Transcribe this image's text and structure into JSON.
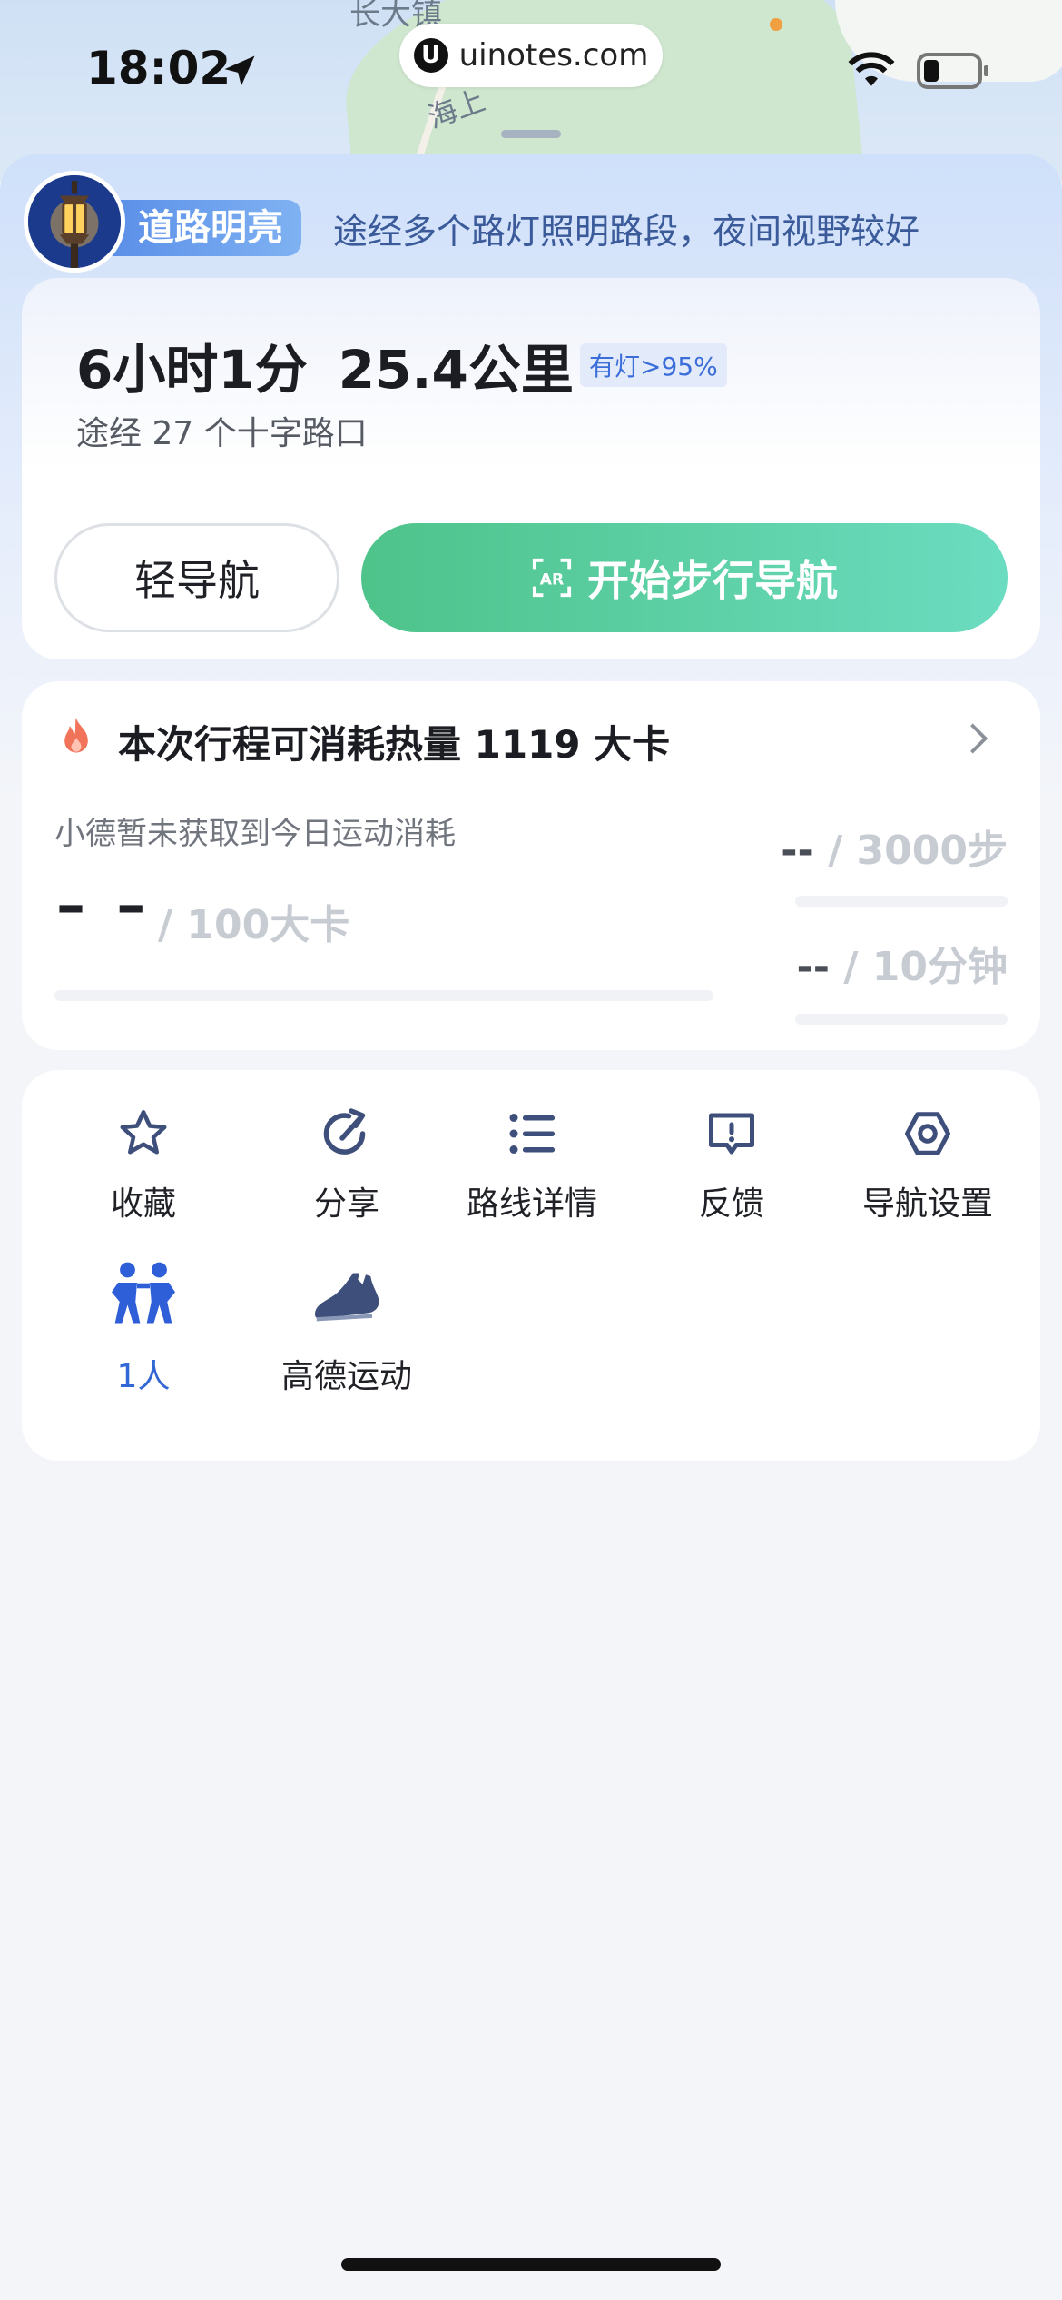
{
  "status_bar": {
    "time": "18:02",
    "url": "uinotes.com"
  },
  "map": {
    "place_label": "长大镇",
    "road_label": "海上"
  },
  "banner": {
    "badge": "道路明亮",
    "text": "途经多个路灯照明路段，夜间视野较好"
  },
  "route": {
    "duration": "6小时1分",
    "distance": "25.4公里",
    "light_tag": "有灯>95%",
    "crossings": "途经 27 个十字路口",
    "light_nav_label": "轻导航",
    "start_nav_label": "开始步行导航"
  },
  "calories": {
    "title": "本次行程可消耗热量 1119 大卡",
    "subtitle": "小德暂未获取到今日运动消耗",
    "kcal_value": "– –",
    "kcal_goal": "/ 100大卡",
    "steps_value": "--",
    "steps_goal": " / 3000步",
    "minutes_value": "--",
    "minutes_goal": " / 10分钟"
  },
  "actions": [
    {
      "label": "收藏",
      "icon": "star-icon"
    },
    {
      "label": "分享",
      "icon": "share-icon"
    },
    {
      "label": "路线详情",
      "icon": "list-icon"
    },
    {
      "label": "反馈",
      "icon": "feedback-icon"
    },
    {
      "label": "导航设置",
      "icon": "settings-icon"
    },
    {
      "label": "1人",
      "icon": "people-icon"
    },
    {
      "label": "高德运动",
      "icon": "sneaker-icon"
    }
  ],
  "colors": {
    "accent_green": "#4ec38a",
    "accent_blue": "#3367d6",
    "icon_navy": "#3d4f7a"
  }
}
